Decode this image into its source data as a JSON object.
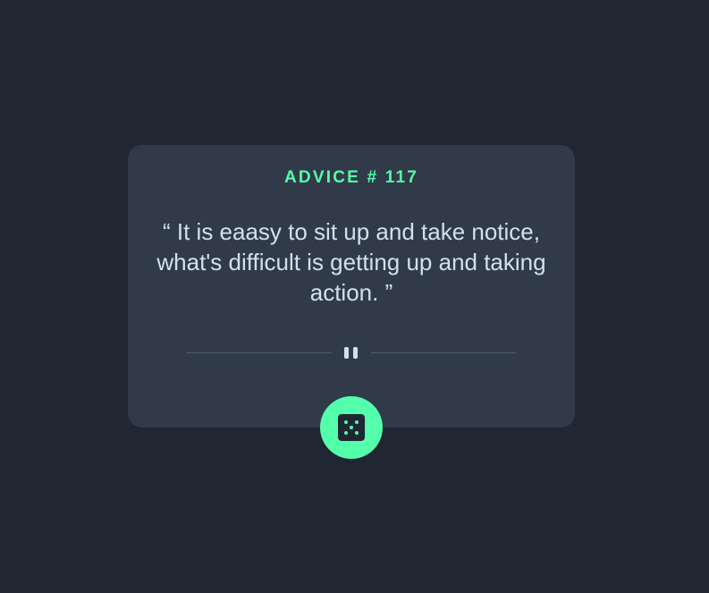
{
  "card": {
    "title": "ADVICE # 117",
    "quote": "“ It is eaasy to sit up and take notice, what's difficult is getting up and taking action. ”"
  },
  "divider": {
    "icon": "pause-icon"
  },
  "button": {
    "icon": "dice-icon"
  },
  "colors": {
    "background": "#202632",
    "card": "#313a49",
    "accent": "#53ffaa",
    "text": "#cee3e9",
    "divider_line": "#4f5d74"
  }
}
